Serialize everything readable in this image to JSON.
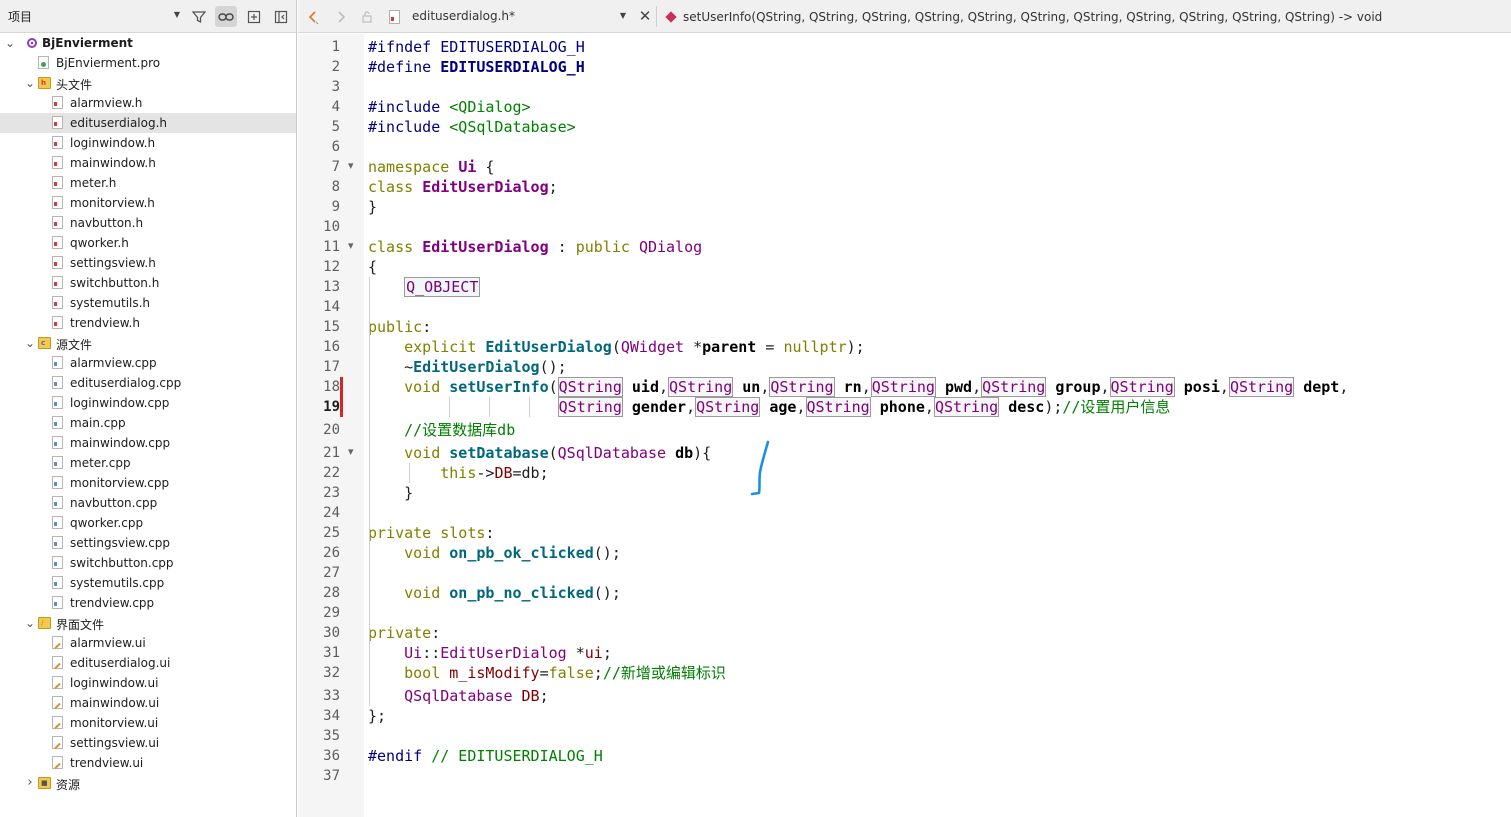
{
  "project_panel": {
    "selector_label": "项目",
    "toolbar_icons": [
      "filter-icon",
      "link-icon",
      "split-icon",
      "collapse-icon"
    ],
    "tree": [
      {
        "label": "BjEnvierment",
        "kind": "project",
        "expanded": true,
        "indent": 0
      },
      {
        "label": "BjEnvierment.pro",
        "kind": "pro",
        "indent": 1
      },
      {
        "label": "头文件",
        "kind": "folder-h",
        "expanded": true,
        "indent": 1
      },
      {
        "label": "alarmview.h",
        "kind": "h",
        "indent": 2
      },
      {
        "label": "edituserdialog.h",
        "kind": "h",
        "indent": 2,
        "selected": true
      },
      {
        "label": "loginwindow.h",
        "kind": "h",
        "indent": 2
      },
      {
        "label": "mainwindow.h",
        "kind": "h",
        "indent": 2
      },
      {
        "label": "meter.h",
        "kind": "h",
        "indent": 2
      },
      {
        "label": "monitorview.h",
        "kind": "h",
        "indent": 2
      },
      {
        "label": "navbutton.h",
        "kind": "h",
        "indent": 2
      },
      {
        "label": "qworker.h",
        "kind": "h",
        "indent": 2
      },
      {
        "label": "settingsview.h",
        "kind": "h",
        "indent": 2
      },
      {
        "label": "switchbutton.h",
        "kind": "h",
        "indent": 2
      },
      {
        "label": "systemutils.h",
        "kind": "h",
        "indent": 2
      },
      {
        "label": "trendview.h",
        "kind": "h",
        "indent": 2
      },
      {
        "label": "源文件",
        "kind": "folder-cpp",
        "expanded": true,
        "indent": 1
      },
      {
        "label": "alarmview.cpp",
        "kind": "cpp",
        "indent": 2
      },
      {
        "label": "edituserdialog.cpp",
        "kind": "cpp",
        "indent": 2
      },
      {
        "label": "loginwindow.cpp",
        "kind": "cpp",
        "indent": 2
      },
      {
        "label": "main.cpp",
        "kind": "cpp",
        "indent": 2
      },
      {
        "label": "mainwindow.cpp",
        "kind": "cpp",
        "indent": 2
      },
      {
        "label": "meter.cpp",
        "kind": "cpp",
        "indent": 2
      },
      {
        "label": "monitorview.cpp",
        "kind": "cpp",
        "indent": 2
      },
      {
        "label": "navbutton.cpp",
        "kind": "cpp",
        "indent": 2
      },
      {
        "label": "qworker.cpp",
        "kind": "cpp",
        "indent": 2
      },
      {
        "label": "settingsview.cpp",
        "kind": "cpp",
        "indent": 2
      },
      {
        "label": "switchbutton.cpp",
        "kind": "cpp",
        "indent": 2
      },
      {
        "label": "systemutils.cpp",
        "kind": "cpp",
        "indent": 2
      },
      {
        "label": "trendview.cpp",
        "kind": "cpp",
        "indent": 2
      },
      {
        "label": "界面文件",
        "kind": "folder-ui",
        "expanded": true,
        "indent": 1
      },
      {
        "label": "alarmview.ui",
        "kind": "ui",
        "indent": 2
      },
      {
        "label": "edituserdialog.ui",
        "kind": "ui",
        "indent": 2
      },
      {
        "label": "loginwindow.ui",
        "kind": "ui",
        "indent": 2
      },
      {
        "label": "mainwindow.ui",
        "kind": "ui",
        "indent": 2
      },
      {
        "label": "monitorview.ui",
        "kind": "ui",
        "indent": 2
      },
      {
        "label": "settingsview.ui",
        "kind": "ui",
        "indent": 2
      },
      {
        "label": "trendview.ui",
        "kind": "ui",
        "indent": 2
      },
      {
        "label": "资源",
        "kind": "folder-res",
        "expanded": false,
        "indent": 1
      }
    ]
  },
  "editor": {
    "file_name": "edituserdialog.h*",
    "symbol": "setUserInfo(QString, QString, QString, QString, QString, QString, QString, QString, QString, QString, QString) -> void",
    "current_line": 19,
    "modified_lines": [
      18,
      19
    ],
    "fold_lines": [
      7,
      11,
      21
    ],
    "line_numbers": [
      "1",
      "2",
      "3",
      "4",
      "5",
      "6",
      "7",
      "8",
      "9",
      "10",
      "11",
      "12",
      "13",
      "14",
      "15",
      "16",
      "17",
      "18",
      "19",
      "20",
      "21",
      "22",
      "23",
      "24",
      "25",
      "26",
      "27",
      "28",
      "29",
      "30",
      "31",
      "32",
      "33",
      "34",
      "35",
      "36",
      "37"
    ],
    "lines": [
      [
        [
          "pp",
          "#ifndef "
        ],
        [
          "pp-id",
          "EDITUSERDIALOG_H"
        ]
      ],
      [
        [
          "pp",
          "#define "
        ],
        [
          "pp-bold",
          "EDITUSERDIALOG_H"
        ]
      ],
      [],
      [
        [
          "pp",
          "#include "
        ],
        [
          "inc",
          "<QDialog>"
        ]
      ],
      [
        [
          "pp",
          "#include "
        ],
        [
          "inc",
          "<QSqlDatabase>"
        ]
      ],
      [],
      [
        [
          "kw",
          "namespace "
        ],
        [
          "cls-b",
          "Ui"
        ],
        [
          "plain",
          " {"
        ]
      ],
      [
        [
          "kw",
          "class "
        ],
        [
          "cls-b",
          "EditUserDialog"
        ],
        [
          "plain",
          ";"
        ]
      ],
      [
        [
          "plain",
          "}"
        ]
      ],
      [],
      [
        [
          "kw",
          "class "
        ],
        [
          "cls-b",
          "EditUserDialog"
        ],
        [
          "plain",
          " : "
        ],
        [
          "kw",
          "public "
        ],
        [
          "cls",
          "QDialog"
        ]
      ],
      [
        [
          "plain",
          "{"
        ]
      ],
      [
        [
          "plain",
          "    "
        ],
        [
          "qobj",
          "Q_OBJECT"
        ]
      ],
      [],
      [
        [
          "kw",
          "public"
        ],
        [
          "plain",
          ":"
        ]
      ],
      [
        [
          "plain",
          "    "
        ],
        [
          "kw",
          "explicit "
        ],
        [
          "fn",
          "EditUserDialog"
        ],
        [
          "plain",
          "("
        ],
        [
          "cls",
          "QWidget"
        ],
        [
          "plain",
          " *"
        ],
        [
          "param",
          "parent"
        ],
        [
          "plain",
          " = "
        ],
        [
          "kw",
          "nullptr"
        ],
        [
          "plain",
          ");"
        ]
      ],
      [
        [
          "plain",
          "    ~"
        ],
        [
          "fn",
          "EditUserDialog"
        ],
        [
          "plain",
          "();"
        ]
      ],
      [
        [
          "plain",
          "    "
        ],
        [
          "kw",
          "void "
        ],
        [
          "fn",
          "setUserInfo"
        ],
        [
          "plain",
          "("
        ],
        [
          "qs",
          "QString"
        ],
        [
          "plain",
          " "
        ],
        [
          "param",
          "uid"
        ],
        [
          "plain",
          ","
        ],
        [
          "qs",
          "QString"
        ],
        [
          "plain",
          " "
        ],
        [
          "param",
          "un"
        ],
        [
          "plain",
          ","
        ],
        [
          "qs",
          "QString"
        ],
        [
          "plain",
          " "
        ],
        [
          "param",
          "rn"
        ],
        [
          "plain",
          ","
        ],
        [
          "qs",
          "QString"
        ],
        [
          "plain",
          " "
        ],
        [
          "param",
          "pwd"
        ],
        [
          "plain",
          ","
        ],
        [
          "qs",
          "QString"
        ],
        [
          "plain",
          " "
        ],
        [
          "param",
          "group"
        ],
        [
          "plain",
          ","
        ],
        [
          "qs",
          "QString"
        ],
        [
          "plain",
          " "
        ],
        [
          "param",
          "posi"
        ],
        [
          "plain",
          ","
        ],
        [
          "qs",
          "QString"
        ],
        [
          "plain",
          " "
        ],
        [
          "param",
          "dept"
        ],
        [
          "plain",
          ","
        ]
      ],
      [
        [
          "plain",
          "                     "
        ],
        [
          "qs",
          "QString"
        ],
        [
          "plain",
          " "
        ],
        [
          "param",
          "gender"
        ],
        [
          "plain",
          ","
        ],
        [
          "qs",
          "QString"
        ],
        [
          "plain",
          " "
        ],
        [
          "param",
          "age"
        ],
        [
          "plain",
          ","
        ],
        [
          "qs",
          "QString"
        ],
        [
          "plain",
          " "
        ],
        [
          "param",
          "phone"
        ],
        [
          "plain",
          ","
        ],
        [
          "qs",
          "QString"
        ],
        [
          "plain",
          " "
        ],
        [
          "param",
          "desc"
        ],
        [
          "plain",
          ");"
        ],
        [
          "cmt",
          "//设置用户信息"
        ]
      ],
      [
        [
          "plain",
          "    "
        ],
        [
          "cmt",
          "//设置数据库db"
        ]
      ],
      [
        [
          "plain",
          "    "
        ],
        [
          "kw",
          "void "
        ],
        [
          "fn",
          "setDatabase"
        ],
        [
          "plain",
          "("
        ],
        [
          "cls",
          "QSqlDatabase"
        ],
        [
          "plain",
          " "
        ],
        [
          "param",
          "db"
        ],
        [
          "plain",
          "){"
        ]
      ],
      [
        [
          "plain",
          "        "
        ],
        [
          "kw",
          "this"
        ],
        [
          "plain",
          "->"
        ],
        [
          "mem",
          "DB"
        ],
        [
          "plain",
          "=db;"
        ]
      ],
      [
        [
          "plain",
          "    }"
        ]
      ],
      [],
      [
        [
          "kw",
          "private slots"
        ],
        [
          "plain",
          ":"
        ]
      ],
      [
        [
          "plain",
          "    "
        ],
        [
          "kw",
          "void "
        ],
        [
          "fn",
          "on_pb_ok_clicked"
        ],
        [
          "plain",
          "();"
        ]
      ],
      [],
      [
        [
          "plain",
          "    "
        ],
        [
          "kw",
          "void "
        ],
        [
          "fn",
          "on_pb_no_clicked"
        ],
        [
          "plain",
          "();"
        ]
      ],
      [],
      [
        [
          "kw",
          "private"
        ],
        [
          "plain",
          ":"
        ]
      ],
      [
        [
          "plain",
          "    "
        ],
        [
          "cls",
          "Ui"
        ],
        [
          "plain",
          "::"
        ],
        [
          "cls",
          "EditUserDialog"
        ],
        [
          "plain",
          " *"
        ],
        [
          "mem",
          "ui"
        ],
        [
          "plain",
          ";"
        ]
      ],
      [
        [
          "plain",
          "    "
        ],
        [
          "kw",
          "bool "
        ],
        [
          "mem",
          "m_isModify"
        ],
        [
          "plain",
          "="
        ],
        [
          "kw",
          "false"
        ],
        [
          "plain",
          ";"
        ],
        [
          "cmt",
          "//新增或编辑标识"
        ]
      ],
      [
        [
          "plain",
          "    "
        ],
        [
          "cls",
          "QSqlDatabase"
        ],
        [
          "plain",
          " "
        ],
        [
          "mem",
          "DB"
        ],
        [
          "plain",
          ";"
        ]
      ],
      [
        [
          "plain",
          "};"
        ]
      ],
      [],
      [
        [
          "pp",
          "#endif "
        ],
        [
          "cmt",
          "// EDITUSERDIALOG_H"
        ]
      ],
      []
    ]
  }
}
